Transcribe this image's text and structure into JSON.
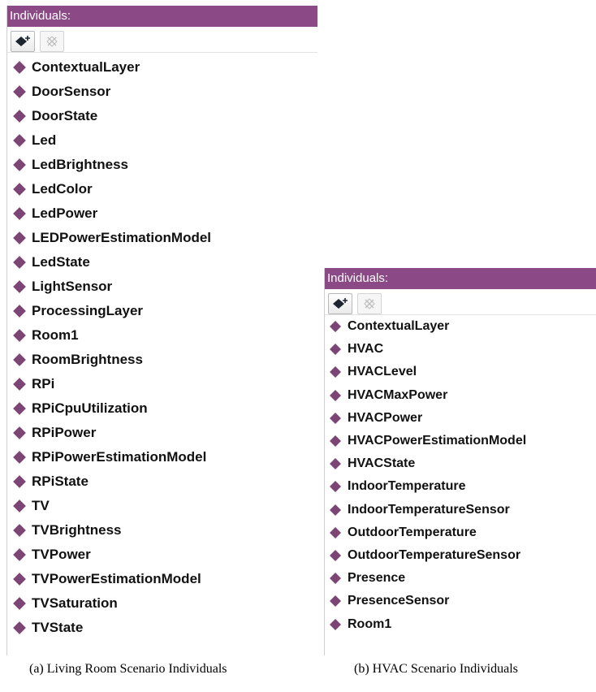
{
  "colors": {
    "header": "#8b4a86",
    "diamond": "#7c4576"
  },
  "panel_a": {
    "header": "Individuals:",
    "toolbar": {
      "add_icon": "add-individual-icon",
      "delete_icon": "delete-individual-icon"
    },
    "items": [
      "ContextualLayer",
      "DoorSensor",
      "DoorState",
      "Led",
      "LedBrightness",
      "LedColor",
      "LedPower",
      "LEDPowerEstimationModel",
      "LedState",
      "LightSensor",
      "ProcessingLayer",
      "Room1",
      "RoomBrightness",
      "RPi",
      "RPiCpuUtilization",
      "RPiPower",
      "RPiPowerEstimationModel",
      "RPiState",
      "TV",
      "TVBrightness",
      "TVPower",
      "TVPowerEstimationModel",
      "TVSaturation",
      "TVState"
    ]
  },
  "panel_b": {
    "header": "Individuals:",
    "toolbar": {
      "add_icon": "add-individual-icon",
      "delete_icon": "delete-individual-icon"
    },
    "items": [
      "ContextualLayer",
      "HVAC",
      "HVACLevel",
      "HVACMaxPower",
      "HVACPower",
      "HVACPowerEstimationModel",
      "HVACState",
      "IndoorTemperature",
      "IndoorTemperatureSensor",
      "OutdoorTemperature",
      "OutdoorTemperatureSensor",
      "Presence",
      "PresenceSensor",
      "Room1"
    ]
  },
  "captions": {
    "a": "(a)  Living Room Scenario Individuals",
    "b": "(b)  HVAC Scenario Individuals"
  }
}
